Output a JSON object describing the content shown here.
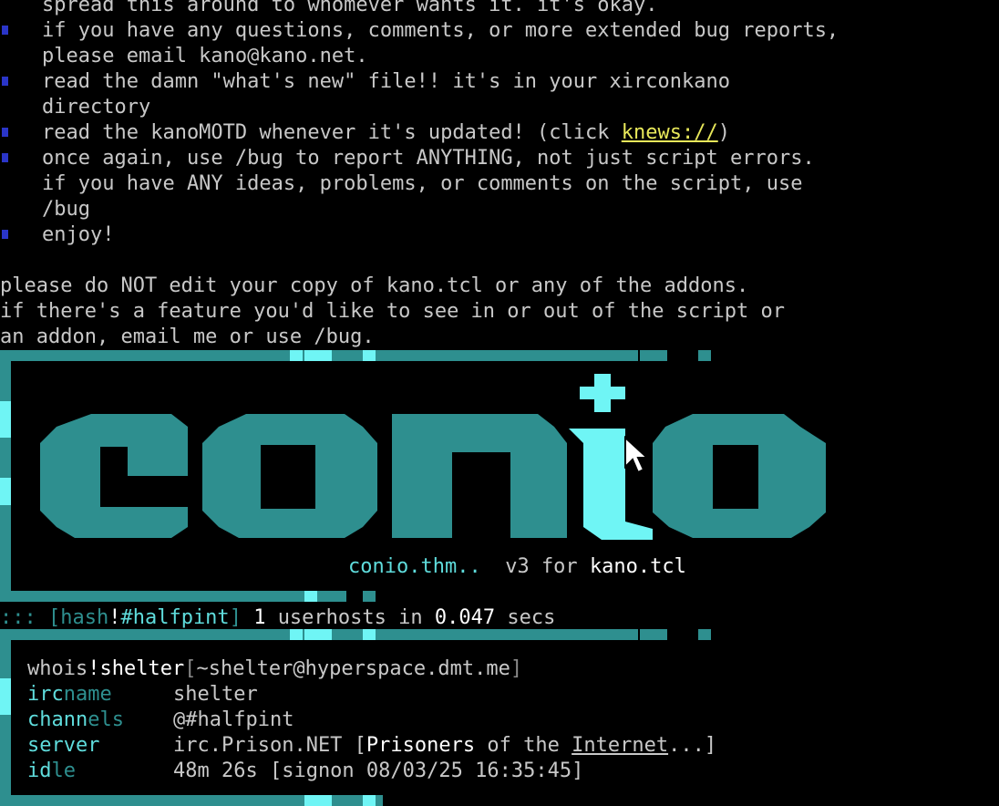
{
  "motd": {
    "lines": [
      "spread this around to whomever wants it. it's okay.",
      "if you have any questions, comments, or more extended bug reports,",
      "please email kano@kano.net.",
      "read the damn \"what's new\" file!! it's in your xirconkano",
      "directory",
      "read the kanoMOTD whenever it's updated! (click ",
      "once again, use /bug to report ANYTHING, not just script errors.",
      "if you have ANY ideas, problems, or comments on the script, use",
      "/bug",
      "enjoy!"
    ],
    "link": "knews://",
    "link_suffix": ")",
    "footer": [
      "please do NOT edit your copy of kano.tcl or any of the addons.",
      "if there's a feature you'd like to see in or out of the script or",
      "an addon, email me or use /bug."
    ]
  },
  "banner": {
    "logo_text": "conio",
    "theme": "conio.thm..",
    "version": "v3 for",
    "script": "kano.tcl"
  },
  "status": {
    "prefix": "::: [",
    "hash_a": "hash",
    "bang": "!",
    "channel": "#halfpint",
    "close": "]",
    "count": "1",
    "mid": "userhosts in",
    "time": "0.047",
    "unit": "secs"
  },
  "whois": {
    "head_label": "whois",
    "bang": "!",
    "nick": "shelter",
    "open": "[",
    "host": "~shelter@hyperspace.dmt.me",
    "close": "]",
    "ircname_label_a": "irc",
    "ircname_label_b": "name",
    "ircname": "shelter",
    "channels_label_a": "chann",
    "channels_label_b": "els",
    "channels": "@#halfpint",
    "server_label": "server",
    "server": "irc.Prison.NET [",
    "server_desc_a": "Prisoners",
    "server_desc_b": " of the ",
    "server_desc_c": "Internet",
    "server_desc_d": "...]",
    "idle_label_a": "id",
    "idle_label_b": "le",
    "idle": "48m 26s [signon 08/03/25 16:35:45]"
  },
  "colors": {
    "background": "#000000",
    "text": "#c8c8c8",
    "teal": "#2e8f8f",
    "cyan": "#6ff5f5",
    "link": "#e8e85a",
    "bullet": "#2a35c8"
  },
  "icons": [
    "mouse-pointer-icon"
  ]
}
